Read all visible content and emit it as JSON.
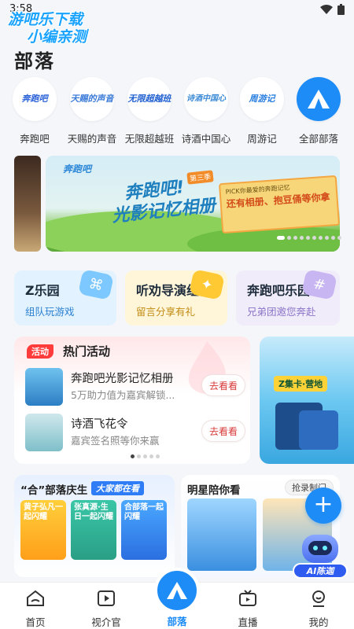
{
  "status_bar": {
    "time": "3:58"
  },
  "watermark": {
    "line1": "游吧乐下载",
    "line2": "小编亲测"
  },
  "page_title": "部落",
  "circles": [
    {
      "label": "奔跑吧",
      "logo": "奔跑吧"
    },
    {
      "label": "天赐的声音",
      "logo": "天赐的声音"
    },
    {
      "label": "无限超越班",
      "logo": "无限超越班"
    },
    {
      "label": "诗酒中国心",
      "logo": "诗酒中国心"
    },
    {
      "label": "周游记",
      "logo": "周游记"
    },
    {
      "label": "全部部落",
      "logo": ""
    }
  ],
  "banner": {
    "logo": "奔跑吧",
    "badge": "第三季",
    "title_line1": "奔跑吧!",
    "title_line2": "光影记忆相册",
    "card_small": "PICK你最爱的奔跑记忆",
    "card_big": "还有相册、抱豆俑等你拿"
  },
  "quick_cards": [
    {
      "title": "Z乐园",
      "subtitle": "组队玩游戏"
    },
    {
      "title": "听劝导演组",
      "subtitle": "留言分享有礼"
    },
    {
      "title": "奔跑吧乐园",
      "subtitle": "兄弟团邀您奔赴"
    }
  ],
  "activity": {
    "badge": "活动",
    "title": "热门活动",
    "items": [
      {
        "name": "奔跑吧光影记忆相册",
        "desc": "5万助力值为嘉宾解锁...",
        "button": "去看看"
      },
      {
        "name": "诗酒飞花令",
        "desc": "嘉宾签名照等你来赢",
        "button": "去看看"
      }
    ]
  },
  "zcard": {
    "label": "Z集卡·营地"
  },
  "bottom_cards": {
    "left": {
      "title": "“合”部落庆生",
      "tag": "大家都在看",
      "tiles": [
        "黄子弘凡一起闪耀",
        "张真源·生日一起闪耀",
        "合部落一起闪耀"
      ]
    },
    "right": {
      "title": "明星陪你看",
      "button": "抢录制门"
    }
  },
  "ai_bot": {
    "label": "AI陈迦"
  },
  "nav": {
    "items": [
      {
        "label": "首页",
        "icon": "home-icon"
      },
      {
        "label": "视介官",
        "icon": "video-icon"
      },
      {
        "label": "部落",
        "icon": "tent-icon"
      },
      {
        "label": "直播",
        "icon": "tv-icon"
      },
      {
        "label": "我的",
        "icon": "profile-icon"
      }
    ]
  },
  "colors": {
    "accent": "#1e8cf6",
    "hot": "#ff3c3c"
  }
}
